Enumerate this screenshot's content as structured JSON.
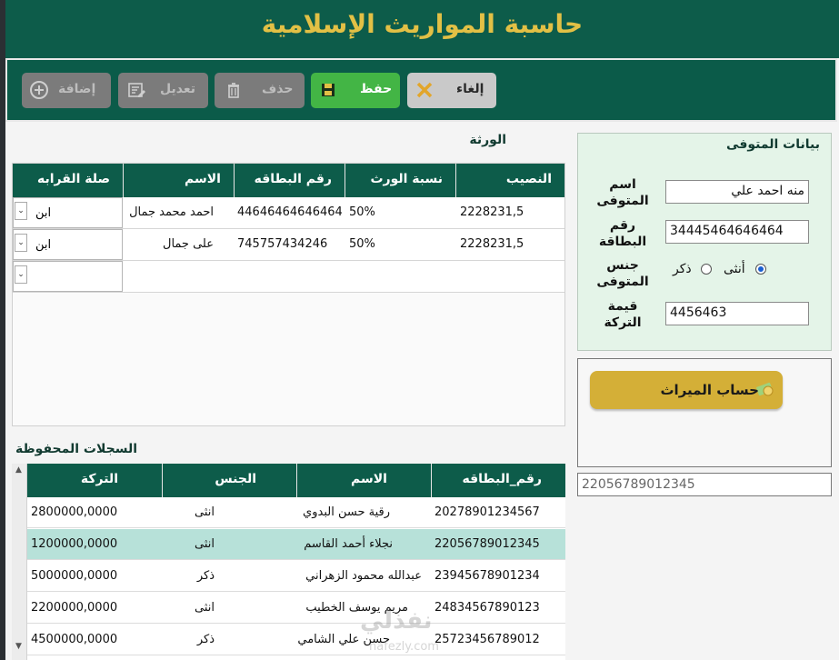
{
  "app": {
    "title": "حاسبة المواريث الإسلامية"
  },
  "toolbar": {
    "add_label": "إضافة",
    "edit_label": "تعديل",
    "delete_label": "حذف",
    "save_label": "حفظ",
    "cancel_label": "إلغاء"
  },
  "heirs": {
    "title": "الورثة",
    "columns": [
      "النصيب",
      "نسبة الورث",
      "رقم البطاقه",
      "الاسم",
      "صلة القرابه"
    ],
    "rows": [
      {
        "share": "2228231,5",
        "percent": "50%",
        "id": "44646464646464",
        "name": "احمد محمد جمال",
        "relation": "ابن"
      },
      {
        "share": "2228231,5",
        "percent": "50%",
        "id": "745757434246",
        "name": "على جمال",
        "relation": "ابن"
      }
    ]
  },
  "deceased": {
    "title": "بيانات المتوفى",
    "name_label_1": "اسم",
    "name_label_2": "المتوفى",
    "name_value": "منه احمد علي",
    "id_label_1": "رقم",
    "id_label_2": "البطاقة",
    "id_value": "34445464646464",
    "gender_label_1": "جنس",
    "gender_label_2": "المتوفى",
    "gender_female": "أنثى",
    "gender_male": "ذكر",
    "estate_label_1": "قيمة",
    "estate_label_2": "التركة",
    "estate_value": "4456463"
  },
  "calc": {
    "label": "حساب الميراث"
  },
  "id_field": {
    "value": "22056789012345"
  },
  "saved": {
    "title": "السجلات المحفوظة",
    "columns": [
      "رقم_البطاقه",
      "الاسم",
      "الجنس",
      "التركة"
    ],
    "rows": [
      {
        "id": "20278901234567",
        "name": "رقية حسن البدوي",
        "gender": "انثى",
        "estate": "2800000,0000"
      },
      {
        "id": "22056789012345",
        "name": "نجلاء أحمد القاسم",
        "gender": "انثى",
        "estate": "1200000,0000"
      },
      {
        "id": "23945678901234",
        "name": "عبدالله محمود الزهراني",
        "gender": "ذكر",
        "estate": "5000000,0000"
      },
      {
        "id": "24834567890123",
        "name": "مريم يوسف الخطيب",
        "gender": "انثى",
        "estate": "2200000,0000"
      },
      {
        "id": "25723456789012",
        "name": "حسن علي الشامي",
        "gender": "ذكر",
        "estate": "4500000,0000"
      }
    ]
  },
  "watermark": {
    "line1": "نفذلي",
    "line2": "nafezly.com"
  },
  "colors": {
    "primary": "#0d5c4a",
    "accent": "#d4af37",
    "save": "#43b545",
    "selected_row": "#b7e1d9"
  }
}
